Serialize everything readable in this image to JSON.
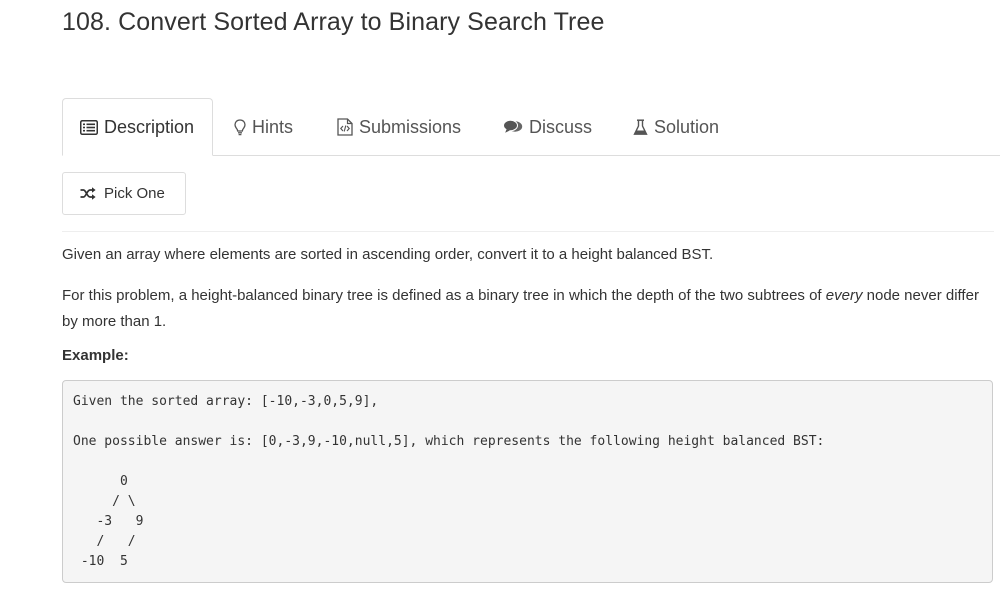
{
  "problem": {
    "title": "108. Convert Sorted Array to Binary Search Tree"
  },
  "tabs": [
    {
      "label": "Description",
      "icon": "list-icon",
      "active": true
    },
    {
      "label": "Hints",
      "icon": "lightbulb-icon"
    },
    {
      "label": "Submissions",
      "icon": "code-file-icon"
    },
    {
      "label": "Discuss",
      "icon": "comments-icon"
    },
    {
      "label": "Solution",
      "icon": "flask-icon"
    }
  ],
  "pick_one": {
    "label": "Pick One",
    "icon": "shuffle-icon"
  },
  "description": {
    "paragraph1": "Given an array where elements are sorted in ascending order, convert it to a height balanced BST.",
    "paragraph2_before": "For this problem, a height-balanced binary tree is defined as a binary tree in which the depth of the two subtrees of ",
    "paragraph2_emphasis": "every",
    "paragraph2_after": " node never differ by more than 1.",
    "example_heading": "Example:",
    "example_code": "Given the sorted array: [-10,-3,0,5,9],\n\nOne possible answer is: [0,-3,9,-10,null,5], which represents the following height balanced BST:\n\n      0\n     / \\\n   -3   9\n   /   /\n -10  5"
  }
}
